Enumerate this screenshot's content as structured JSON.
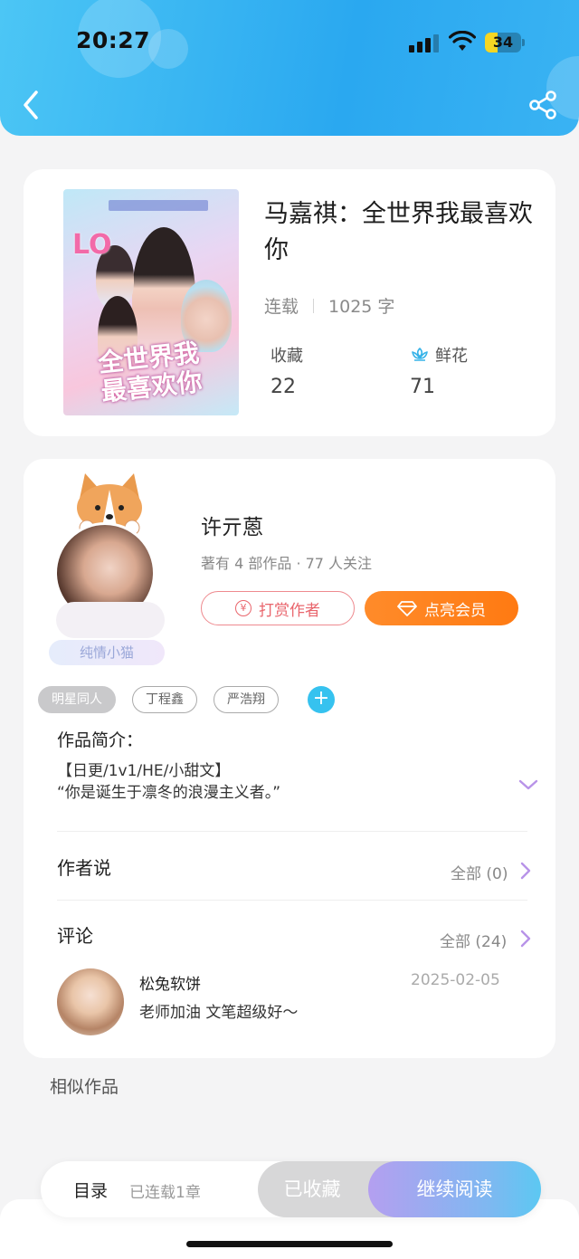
{
  "status_bar": {
    "time": "20:27",
    "battery": "34",
    "battery_level": 0.34
  },
  "header": {
    "back_icon": "chevron-left-icon",
    "share_icon": "share-icon"
  },
  "book": {
    "title": "马嘉祺：全世界我最喜欢你",
    "status": "连载",
    "word_count": "1025 字",
    "favorites_label": "收藏",
    "favorites_count": "22",
    "flowers_label": "鲜花",
    "flowers_count": "71"
  },
  "author": {
    "name": "许亓蒽",
    "meta": "著有 4 部作品 · 77 人关注",
    "badge": "纯情小猫",
    "tip_label": "打赏作者",
    "vip_label": "点亮会员"
  },
  "tags": [
    "明星同人",
    "丁程鑫",
    "严浩翔"
  ],
  "tag_add": "+",
  "intro": {
    "label": "作品简介：",
    "line1": "【日更/1v1/HE/小甜文】",
    "line2": "“你是诞生于凛冬的浪漫主义者。”"
  },
  "author_says": {
    "label": "作者说",
    "more": "全部 (0)"
  },
  "comments": {
    "label": "评论",
    "more": "全部 (24)",
    "items": [
      {
        "user": "松兔软饼",
        "date": "2025-02-05",
        "text": "老师加油 文笔超级好～"
      }
    ]
  },
  "similar_label": "相似作品",
  "bottom": {
    "toc_label": "目录",
    "toc_status": "已连载1章",
    "fav_label": "已收藏",
    "read_label": "继续阅读"
  },
  "colors": {
    "header": "#2aa8f0",
    "tip": "#e9656c",
    "vip": "#ff8b2a",
    "tag_add": "#36c2ef",
    "chevron": "#b893e8",
    "read_button": "#7eb8f1"
  }
}
